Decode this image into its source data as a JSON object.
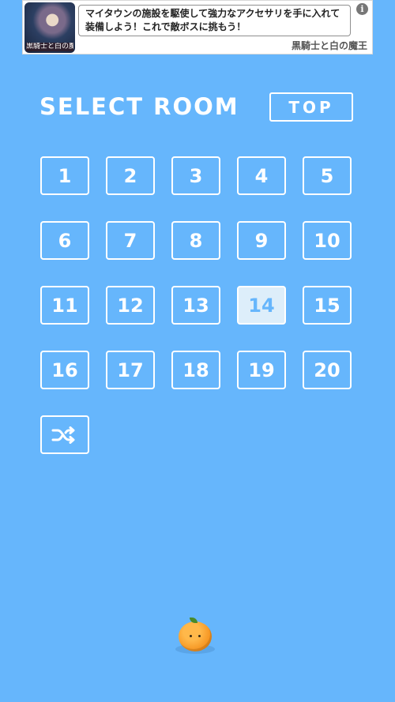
{
  "ad": {
    "thumbnail_caption": "黒騎士と白の魔王",
    "text": "マイタウンの施設を駆使して強力なアクセサリを手に入れて装備しよう！これで敵ボスに挑もう！",
    "brand": "黒騎士と白の魔王",
    "info_glyph": "i"
  },
  "header": {
    "title": "SELECT ROOM",
    "top_button": "TOP"
  },
  "rooms": [
    "1",
    "2",
    "3",
    "4",
    "5",
    "6",
    "7",
    "8",
    "9",
    "10",
    "11",
    "12",
    "13",
    "14",
    "15",
    "16",
    "17",
    "18",
    "19",
    "20"
  ],
  "selected_room": "14",
  "shuffle": {
    "icon": "shuffle-icon"
  },
  "mascot": {
    "icon": "orange-icon"
  },
  "colors": {
    "background": "#66b6fc",
    "button_border": "#ffffff",
    "selected_fill": "#ddeefa",
    "orange": "#f5921e"
  }
}
